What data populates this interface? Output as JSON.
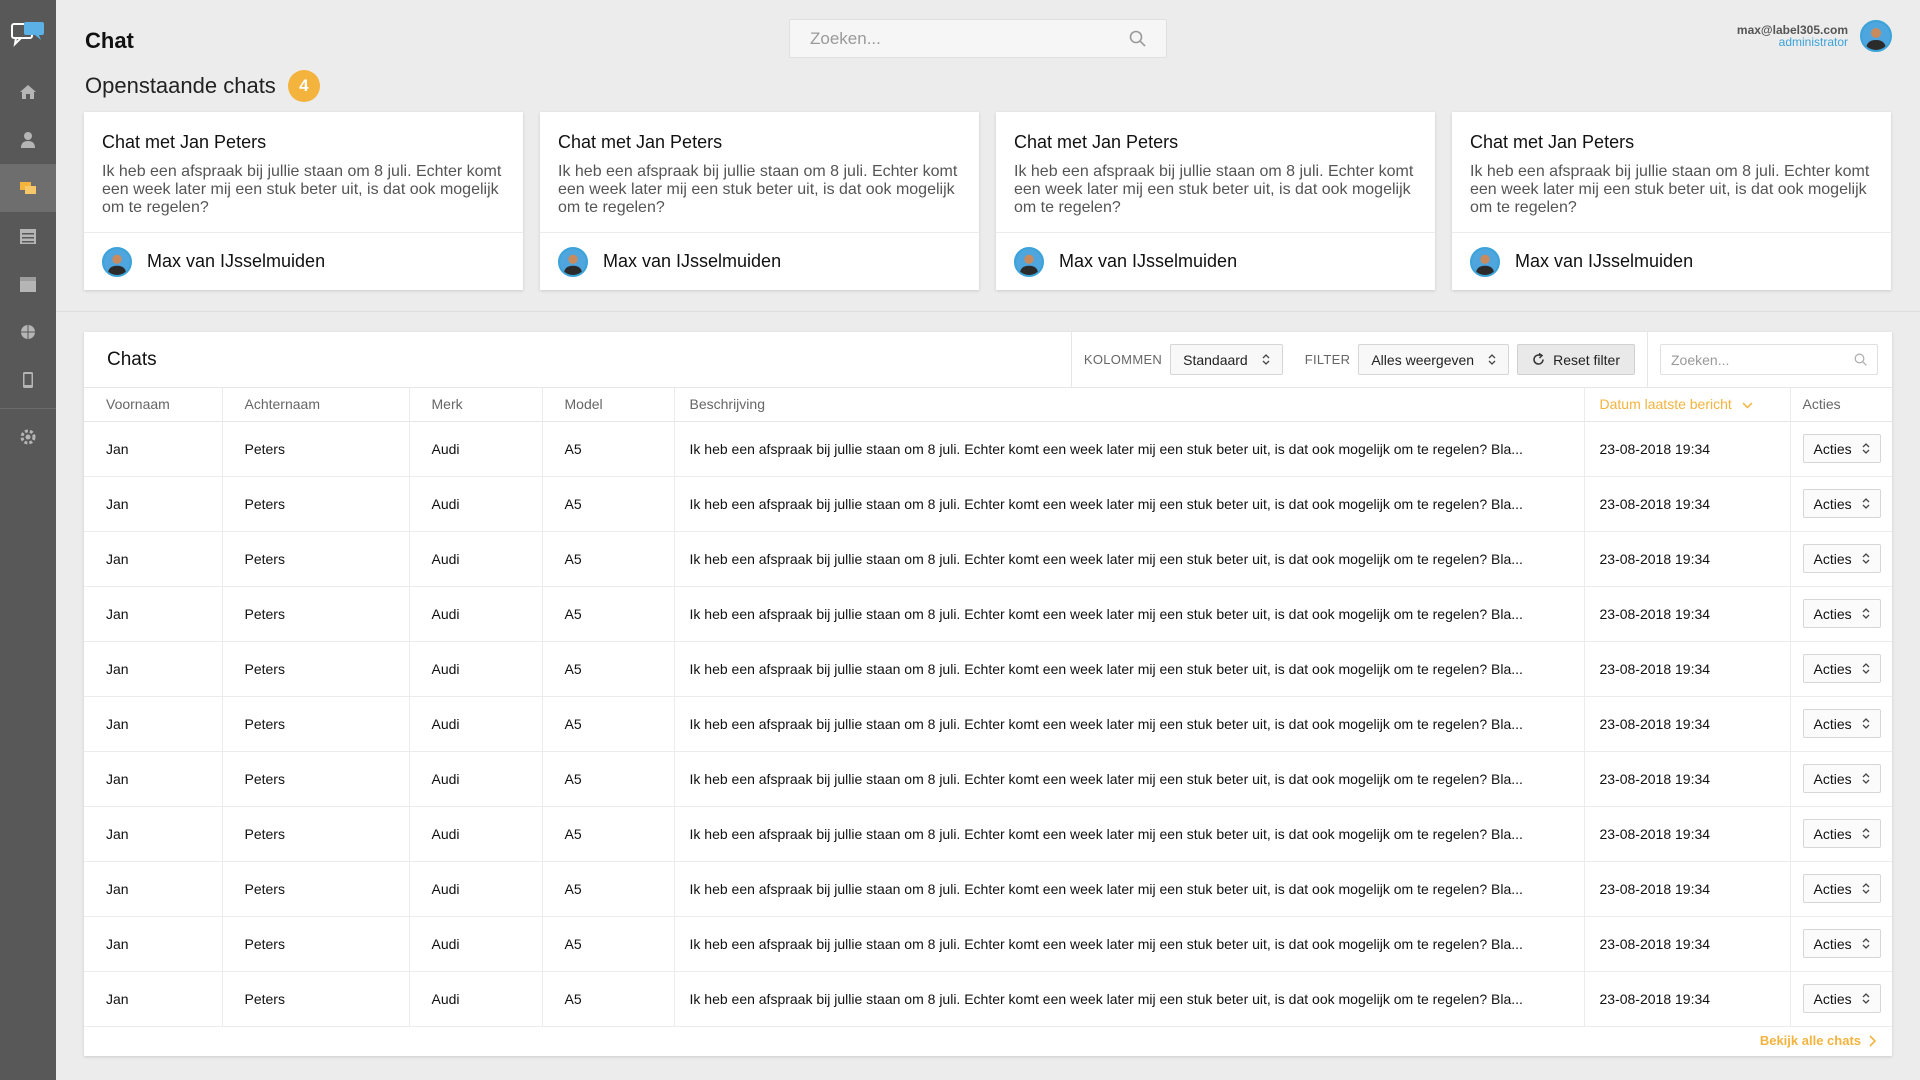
{
  "app": {
    "title": "Chat"
  },
  "search": {
    "placeholder": "Zoeken..."
  },
  "user": {
    "email": "max@label305.com",
    "role": "administrator"
  },
  "open_chats": {
    "title": "Openstaande chats",
    "count": "4",
    "cards": [
      {
        "title": "Chat met Jan Peters",
        "text": "Ik heb een afspraak bij jullie staan om 8 juli. Echter komt een week later mij een stuk beter uit, is dat ook mogelijk om te regelen?",
        "author": "Max van IJsselmuiden"
      },
      {
        "title": "Chat met Jan Peters",
        "text": "Ik heb een afspraak bij jullie staan om 8 juli. Echter komt een week later mij een stuk beter uit, is dat ook mogelijk om te regelen?",
        "author": "Max van IJsselmuiden"
      },
      {
        "title": "Chat met Jan Peters",
        "text": "Ik heb een afspraak bij jullie staan om 8 juli. Echter komt een week later mij een stuk beter uit, is dat ook mogelijk om te regelen?",
        "author": "Max van IJsselmuiden"
      },
      {
        "title": "Chat met Jan Peters",
        "text": "Ik heb een afspraak bij jullie staan om 8 juli. Echter komt een week later mij een stuk beter uit, is dat ook mogelijk om te regelen?",
        "author": "Max van IJsselmuiden"
      }
    ]
  },
  "chats_panel": {
    "title": "Chats",
    "columns_label": "KOLOMMEN",
    "columns_value": "Standaard",
    "filter_label": "FILTER",
    "filter_value": "Alles weergeven",
    "reset_label": "Reset filter",
    "search_placeholder": "Zoeken...",
    "headers": [
      "Voornaam",
      "Achternaam",
      "Merk",
      "Model",
      "Beschrijving",
      "Datum laatste bericht",
      "Acties"
    ],
    "rows": [
      [
        "Jan",
        "Peters",
        "Audi",
        "A5",
        "Ik heb een afspraak bij jullie staan om 8 juli. Echter komt een week later mij een stuk beter uit, is dat ook mogelijk om te regelen? Bla...",
        "23-08-2018 19:34",
        "Acties"
      ],
      [
        "Jan",
        "Peters",
        "Audi",
        "A5",
        "Ik heb een afspraak bij jullie staan om 8 juli. Echter komt een week later mij een stuk beter uit, is dat ook mogelijk om te regelen? Bla...",
        "23-08-2018 19:34",
        "Acties"
      ],
      [
        "Jan",
        "Peters",
        "Audi",
        "A5",
        "Ik heb een afspraak bij jullie staan om 8 juli. Echter komt een week later mij een stuk beter uit, is dat ook mogelijk om te regelen? Bla...",
        "23-08-2018 19:34",
        "Acties"
      ],
      [
        "Jan",
        "Peters",
        "Audi",
        "A5",
        "Ik heb een afspraak bij jullie staan om 8 juli. Echter komt een week later mij een stuk beter uit, is dat ook mogelijk om te regelen? Bla...",
        "23-08-2018 19:34",
        "Acties"
      ],
      [
        "Jan",
        "Peters",
        "Audi",
        "A5",
        "Ik heb een afspraak bij jullie staan om 8 juli. Echter komt een week later mij een stuk beter uit, is dat ook mogelijk om te regelen? Bla...",
        "23-08-2018 19:34",
        "Acties"
      ],
      [
        "Jan",
        "Peters",
        "Audi",
        "A5",
        "Ik heb een afspraak bij jullie staan om 8 juli. Echter komt een week later mij een stuk beter uit, is dat ook mogelijk om te regelen? Bla...",
        "23-08-2018 19:34",
        "Acties"
      ],
      [
        "Jan",
        "Peters",
        "Audi",
        "A5",
        "Ik heb een afspraak bij jullie staan om 8 juli. Echter komt een week later mij een stuk beter uit, is dat ook mogelijk om te regelen? Bla...",
        "23-08-2018 19:34",
        "Acties"
      ],
      [
        "Jan",
        "Peters",
        "Audi",
        "A5",
        "Ik heb een afspraak bij jullie staan om 8 juli. Echter komt een week later mij een stuk beter uit, is dat ook mogelijk om te regelen? Bla...",
        "23-08-2018 19:34",
        "Acties"
      ],
      [
        "Jan",
        "Peters",
        "Audi",
        "A5",
        "Ik heb een afspraak bij jullie staan om 8 juli. Echter komt een week later mij een stuk beter uit, is dat ook mogelijk om te regelen? Bla...",
        "23-08-2018 19:34",
        "Acties"
      ],
      [
        "Jan",
        "Peters",
        "Audi",
        "A5",
        "Ik heb een afspraak bij jullie staan om 8 juli. Echter komt een week later mij een stuk beter uit, is dat ook mogelijk om te regelen? Bla...",
        "23-08-2018 19:34",
        "Acties"
      ],
      [
        "Jan",
        "Peters",
        "Audi",
        "A5",
        "Ik heb een afspraak bij jullie staan om 8 juli. Echter komt een week later mij een stuk beter uit, is dat ook mogelijk om te regelen? Bla...",
        "23-08-2018 19:34",
        "Acties"
      ]
    ],
    "view_all_label": "Bekijk alle chats"
  },
  "sidebar": {
    "icons": [
      "chat-logo-icon",
      "home-icon",
      "user-icon",
      "chats-icon",
      "list-icon",
      "calendar-icon",
      "globe-icon",
      "phone-icon",
      "settings-icon"
    ]
  },
  "colors": {
    "accent": "#f3b33d",
    "sidebar": "#585858",
    "link_blue": "#3aa3d8"
  }
}
